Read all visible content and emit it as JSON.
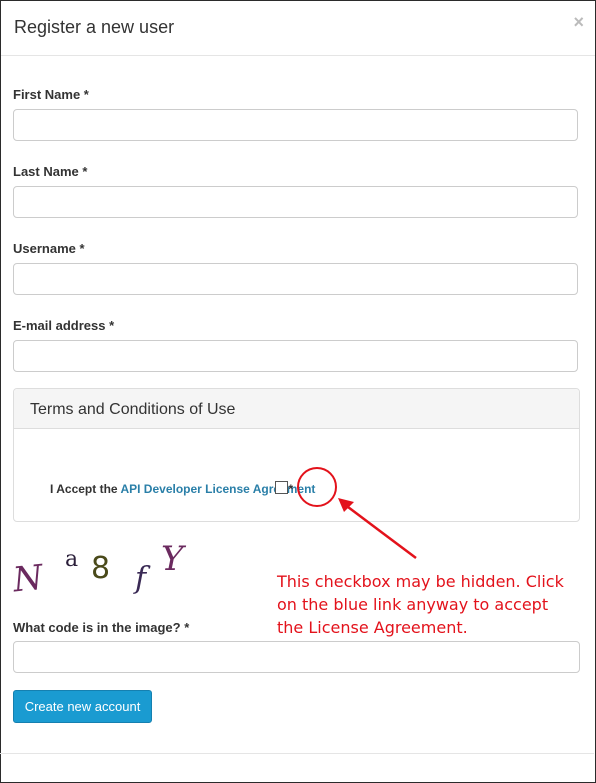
{
  "header": {
    "title": "Register a new user",
    "close_glyph": "×"
  },
  "form": {
    "first_name": {
      "label": "First Name *",
      "value": ""
    },
    "last_name": {
      "label": "Last Name *",
      "value": ""
    },
    "username": {
      "label": "Username *",
      "value": ""
    },
    "email": {
      "label": "E-mail address *",
      "value": ""
    }
  },
  "terms": {
    "title": "Terms and Conditions of Use",
    "accept_prefix": "I Accept the ",
    "link_text": "API Developer License Agreement",
    "required_mark": "*"
  },
  "captcha": {
    "chars": [
      "N",
      "a",
      "8",
      "f",
      "Y"
    ],
    "colors": [
      "#6b2a5f",
      "#2b1f3a",
      "#4a4a1a",
      "#3a2a55",
      "#6b2a5f"
    ],
    "label": "What code is in the image? *",
    "value": ""
  },
  "annotation": {
    "text": "This checkbox may be hidden. Click on the blue link anyway to accept the License Agreement.",
    "color": "#e3121b"
  },
  "actions": {
    "create_label": "Create new account"
  },
  "colors": {
    "primary_button": "#1a9bd1",
    "link": "#2a7fa8",
    "annotation": "#e3121b"
  }
}
